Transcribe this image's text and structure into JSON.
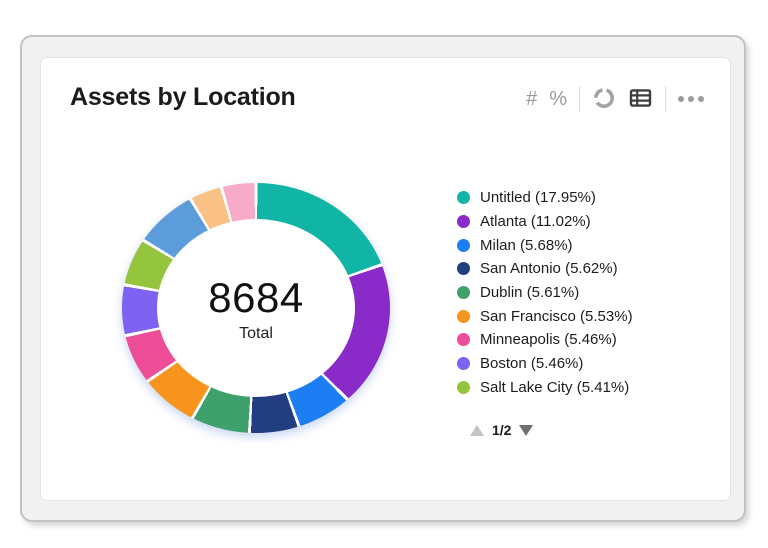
{
  "card": {
    "title": "Assets by Location"
  },
  "toolbar": {
    "number_label": "#",
    "percent_label": "%",
    "icons": [
      "number-format",
      "percent-format",
      "donut-view",
      "table-view",
      "more-options"
    ],
    "active_icon": "table-view",
    "inactive_color": "#9b9b9b",
    "active_color": "#3e3e3e"
  },
  "chart": {
    "total_value": "8684",
    "total_label": "Total"
  },
  "legend": {
    "items": [
      {
        "label": "Untitled (17.95%)",
        "color": "#10b5a5"
      },
      {
        "label": "Atlanta (11.02%)",
        "color": "#8a2bc9"
      },
      {
        "label": "Milan (5.68%)",
        "color": "#1d7df2"
      },
      {
        "label": "San Antonio (5.62%)",
        "color": "#223e80"
      },
      {
        "label": "Dublin (5.61%)",
        "color": "#3ea06a"
      },
      {
        "label": "San Francisco (5.53%)",
        "color": "#f6941d"
      },
      {
        "label": "Minneapolis (5.46%)",
        "color": "#ee4d97"
      },
      {
        "label": "Boston (5.46%)",
        "color": "#7e63f2"
      },
      {
        "label": "Salt Lake City (5.41%)",
        "color": "#94c53d"
      }
    ]
  },
  "pagination": {
    "current": "1/2"
  },
  "chart_data": {
    "type": "pie",
    "subtype": "donut",
    "title": "Assets by Location",
    "center_value": 8684,
    "center_label": "Total",
    "legend_position": "right",
    "legend_page": "1/2",
    "series": [
      {
        "name": "Untitled",
        "percent": 17.95,
        "color": "#10b5a5"
      },
      {
        "name": "Atlanta",
        "percent": 11.02,
        "color": "#8a2bc9"
      },
      {
        "name": "Milan",
        "percent": 5.68,
        "color": "#1d7df2"
      },
      {
        "name": "San Antonio",
        "percent": 5.62,
        "color": "#223e80"
      },
      {
        "name": "Dublin",
        "percent": 5.61,
        "color": "#3ea06a"
      },
      {
        "name": "San Francisco",
        "percent": 5.53,
        "color": "#f6941d"
      },
      {
        "name": "Minneapolis",
        "percent": 5.46,
        "color": "#ee4d97"
      },
      {
        "name": "Boston",
        "percent": 5.46,
        "color": "#7e63f2"
      },
      {
        "name": "Salt Lake City",
        "percent": 5.41,
        "color": "#94c53d"
      }
    ],
    "visual_segments": [
      {
        "name": "Untitled",
        "color": "#10b5a5",
        "start_deg": 0,
        "end_deg": 71
      },
      {
        "name": "Atlanta",
        "color": "#8a2bc9",
        "start_deg": 71,
        "end_deg": 135
      },
      {
        "name": "Milan",
        "color": "#1d7df2",
        "start_deg": 135,
        "end_deg": 160
      },
      {
        "name": "San Antonio",
        "color": "#223e80",
        "start_deg": 160,
        "end_deg": 183
      },
      {
        "name": "Dublin",
        "color": "#3ea06a",
        "start_deg": 183,
        "end_deg": 210
      },
      {
        "name": "San Francisco",
        "color": "#f6941d",
        "start_deg": 210,
        "end_deg": 236
      },
      {
        "name": "Minneapolis",
        "color": "#ee4d97",
        "start_deg": 236,
        "end_deg": 258
      },
      {
        "name": "Boston",
        "color": "#7e63f2",
        "start_deg": 258,
        "end_deg": 280
      },
      {
        "name": "Salt Lake City",
        "color": "#94c53d",
        "start_deg": 280,
        "end_deg": 301
      },
      {
        "name": "",
        "color": "#5d9cdb",
        "start_deg": 301,
        "end_deg": 329
      },
      {
        "name": "",
        "color": "#f9c185",
        "start_deg": 329,
        "end_deg": 344
      },
      {
        "name": "",
        "color": "#f8abc8",
        "start_deg": 344,
        "end_deg": 360
      }
    ],
    "segment_gap_deg": 1.4,
    "gap_color": "#ffffff"
  }
}
